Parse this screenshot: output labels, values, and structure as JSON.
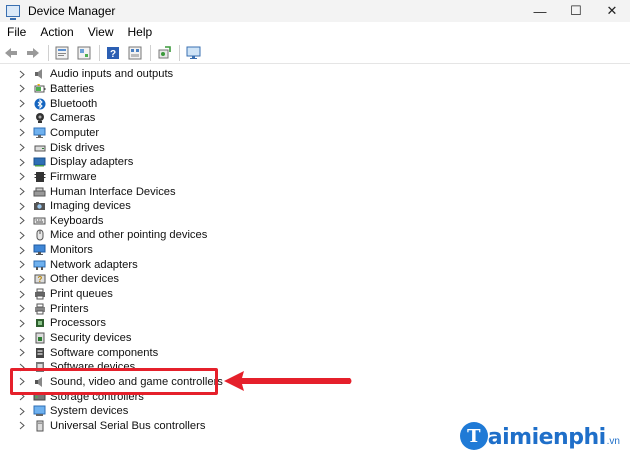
{
  "window": {
    "title": "Device Manager",
    "controls": {
      "minimize": "—",
      "maximize": "☐",
      "close": "✕"
    }
  },
  "menu": [
    "File",
    "Action",
    "View",
    "Help"
  ],
  "toolbar": [
    "back-arrow-icon",
    "forward-arrow-icon",
    "properties-icon",
    "update-driver-icon",
    "help-icon",
    "show-hidden-icon",
    "scan-hardware-icon",
    "monitor-icon"
  ],
  "tree": [
    {
      "label": "Audio inputs and outputs",
      "icon": "speaker-icon"
    },
    {
      "label": "Batteries",
      "icon": "battery-icon"
    },
    {
      "label": "Bluetooth",
      "icon": "bluetooth-icon"
    },
    {
      "label": "Cameras",
      "icon": "camera-icon"
    },
    {
      "label": "Computer",
      "icon": "computer-icon"
    },
    {
      "label": "Disk drives",
      "icon": "disk-icon"
    },
    {
      "label": "Display adapters",
      "icon": "display-icon"
    },
    {
      "label": "Firmware",
      "icon": "firmware-icon"
    },
    {
      "label": "Human Interface Devices",
      "icon": "hid-icon"
    },
    {
      "label": "Imaging devices",
      "icon": "imaging-icon"
    },
    {
      "label": "Keyboards",
      "icon": "keyboard-icon"
    },
    {
      "label": "Mice and other pointing devices",
      "icon": "mouse-icon"
    },
    {
      "label": "Monitors",
      "icon": "monitor-icon"
    },
    {
      "label": "Network adapters",
      "icon": "network-icon"
    },
    {
      "label": "Other devices",
      "icon": "other-devices-icon"
    },
    {
      "label": "Print queues",
      "icon": "print-queue-icon"
    },
    {
      "label": "Printers",
      "icon": "printer-icon"
    },
    {
      "label": "Processors",
      "icon": "processor-icon"
    },
    {
      "label": "Security devices",
      "icon": "security-icon"
    },
    {
      "label": "Software components",
      "icon": "software-component-icon"
    },
    {
      "label": "Software devices",
      "icon": "software-device-icon"
    },
    {
      "label": "Sound, video and game controllers",
      "icon": "sound-icon",
      "highlighted": true
    },
    {
      "label": "Storage controllers",
      "icon": "storage-icon"
    },
    {
      "label": "System devices",
      "icon": "system-icon"
    },
    {
      "label": "Universal Serial Bus controllers",
      "icon": "usb-icon"
    }
  ],
  "annotation": {
    "color": "#e5202b"
  },
  "watermark": {
    "logo_letter": "T",
    "text": "aimienphi",
    "suffix": ".vn"
  },
  "colors": {
    "accent": "#1f7ad6",
    "annotation": "#e5202b"
  }
}
